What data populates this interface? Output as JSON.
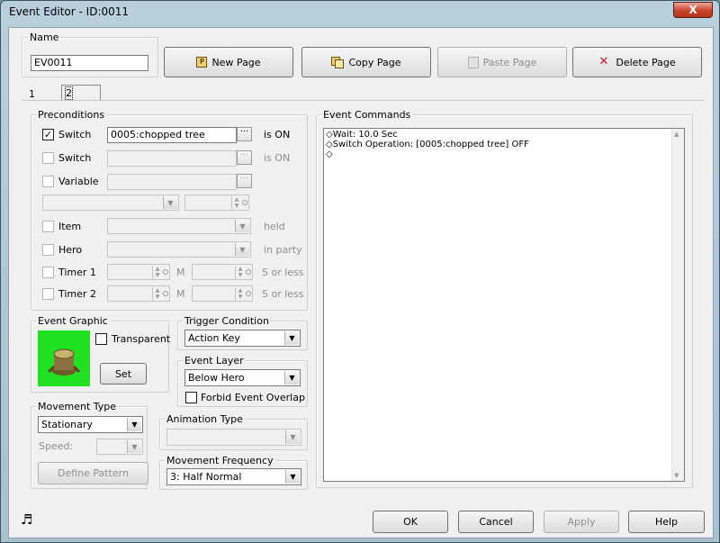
{
  "window": {
    "title": "Event Editor - ID:0011",
    "close_glyph": "X"
  },
  "name": {
    "label": "Name",
    "value": "EV0011"
  },
  "toolbar": {
    "new_page": "New Page",
    "copy_page": "Copy Page",
    "paste_page": "Paste Page",
    "delete_page": "Delete Page"
  },
  "tabs": [
    {
      "label": "1"
    },
    {
      "label": "2"
    }
  ],
  "preconditions": {
    "label": "Preconditions",
    "switch1": {
      "label": "Switch",
      "value": "0005:chopped tree",
      "suffix": "is ON",
      "checked": "✓"
    },
    "switch2": {
      "label": "Switch",
      "value": "",
      "suffix": "is ON"
    },
    "variable": {
      "label": "Variable",
      "value": ""
    },
    "item": {
      "label": "Item",
      "suffix": "held"
    },
    "hero": {
      "label": "Hero",
      "suffix": "in party"
    },
    "timer1": {
      "label": "Timer 1",
      "m": "M",
      "suffix": "S or less"
    },
    "timer2": {
      "label": "Timer 2",
      "m": "M",
      "suffix": "S or less"
    },
    "dots": "···"
  },
  "event_graphic": {
    "label": "Event Graphic",
    "transparent": "Transparent",
    "set": "Set"
  },
  "trigger": {
    "label": "Trigger Condition",
    "value": "Action Key"
  },
  "event_layer": {
    "label": "Event Layer",
    "value": "Below Hero",
    "forbid": "Forbid Event Overlap"
  },
  "movement_type": {
    "label": "Movement Type",
    "value": "Stationary",
    "speed": "Speed:",
    "define": "Define Pattern"
  },
  "animation_type": {
    "label": "Animation Type",
    "value": ""
  },
  "movement_freq": {
    "label": "Movement Frequency",
    "value": "3: Half Normal"
  },
  "commands": {
    "label": "Event Commands",
    "lines": [
      "◇Wait: 10.0 Sec",
      "◇Switch Operation: [0005:chopped tree] OFF",
      "◇"
    ]
  },
  "footer": {
    "ok": "OK",
    "cancel": "Cancel",
    "apply": "Apply",
    "help": "Help",
    "music_icon": "♬"
  },
  "colors": {
    "graphic_bg": "#22e022",
    "titlebar": "#b9d0dc"
  }
}
